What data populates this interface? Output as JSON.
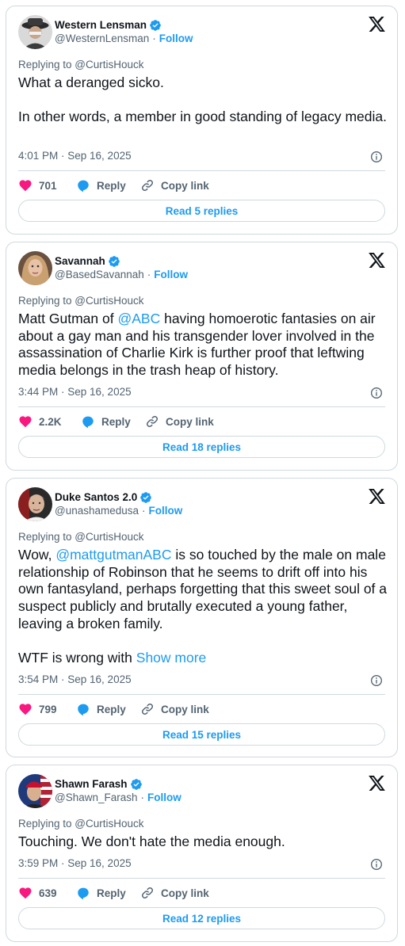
{
  "tweets": [
    {
      "name": "Western Lensman",
      "handle": "@WesternLensman",
      "follow": "Follow",
      "replying": "Replying to @CurtisHouck",
      "text_parts": [
        "What a deranged sicko.\n\nIn other words, a member in good standing of legacy media."
      ],
      "time": "4:01 PM · Sep 16, 2025",
      "likes": "701",
      "reply_label": "Reply",
      "copy_label": "Copy link",
      "read_replies": "Read 5 replies"
    },
    {
      "name": "Savannah",
      "handle": "@BasedSavannah",
      "follow": "Follow",
      "replying": "Replying to @CurtisHouck",
      "text_before": "Matt Gutman of ",
      "text_link": "@ABC",
      "text_after": " having homoerotic fantasies on air about a gay man and his transgender lover involved in the assassination of Charlie Kirk is further proof that leftwing media belongs in the trash heap of history.",
      "time": "3:44 PM · Sep 16, 2025",
      "likes": "2.2K",
      "reply_label": "Reply",
      "copy_label": "Copy link",
      "read_replies": "Read 18 replies"
    },
    {
      "name": "Duke Santos 2.0",
      "handle": "@unashamedusa",
      "follow": "Follow",
      "replying": "Replying to @CurtisHouck",
      "text_before": "Wow, ",
      "text_link": "@mattgutmanABC",
      "text_after": " is so touched by the male on male relationship of Robinson that he seems to drift off into his own fantasyland, perhaps forgetting that this sweet soul of a suspect publicly and brutally executed a young father, leaving a broken family.\n\nWTF is wrong with ",
      "show_more": "Show more",
      "time": "3:54 PM · Sep 16, 2025",
      "likes": "799",
      "reply_label": "Reply",
      "copy_label": "Copy link",
      "read_replies": "Read 15 replies"
    },
    {
      "name": "Shawn Farash",
      "handle": "@Shawn_Farash",
      "follow": "Follow",
      "replying": "Replying to @CurtisHouck",
      "text_parts": [
        "Touching. We don't hate the media enough."
      ],
      "time": "3:59 PM · Sep 16, 2025",
      "likes": "639",
      "reply_label": "Reply",
      "copy_label": "Copy link",
      "read_replies": "Read 12 replies"
    }
  ],
  "colors": {
    "accent": "#1d9bf0",
    "like": "#f91880",
    "text": "#0f1419",
    "secondary": "#536471",
    "border": "#cfd9de"
  },
  "icons": [
    "verified-badge-icon",
    "x-logo-icon",
    "info-icon",
    "heart-icon",
    "reply-bubble-icon",
    "link-icon"
  ]
}
